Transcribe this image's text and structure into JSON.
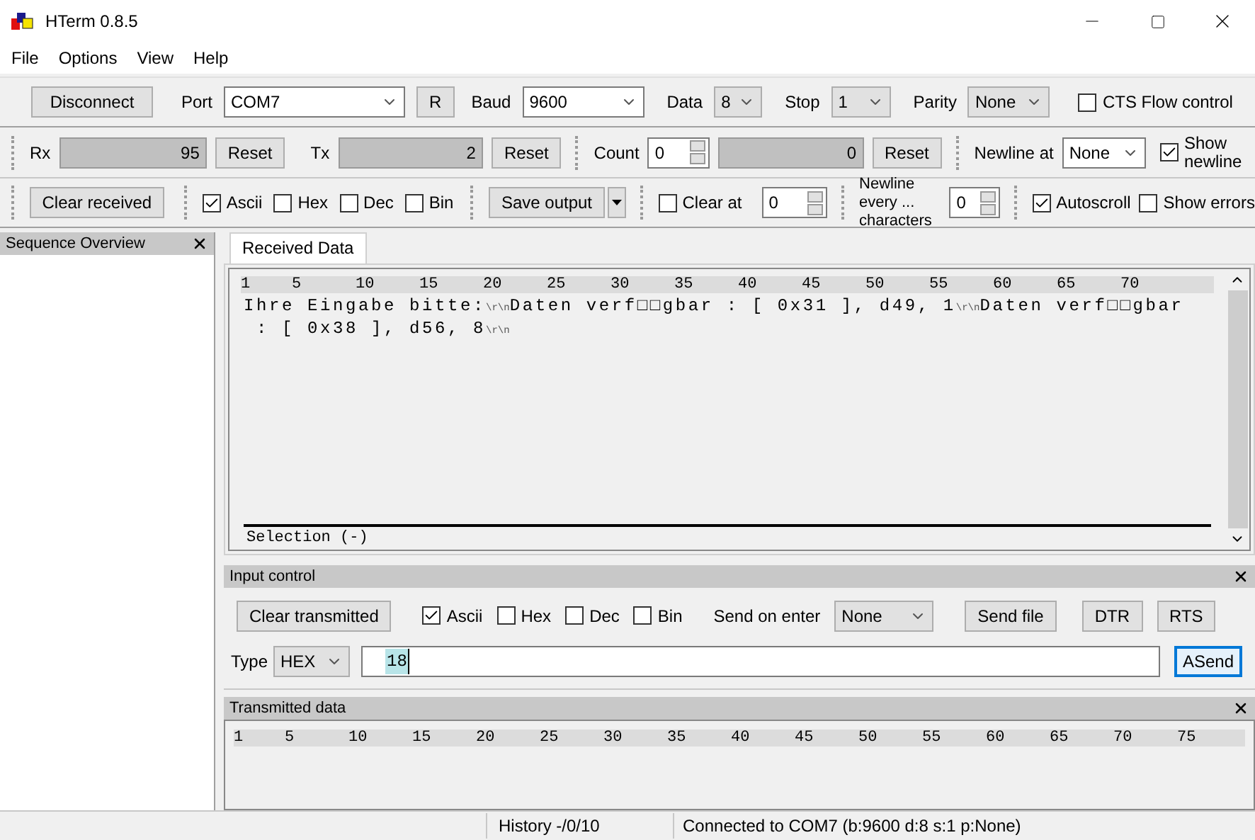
{
  "window": {
    "title": "HTerm 0.8.5"
  },
  "menu": [
    "File",
    "Options",
    "View",
    "Help"
  ],
  "connection": {
    "connect_button": "Disconnect",
    "port_label": "Port",
    "port": "COM7",
    "refresh_button": "R",
    "baud_label": "Baud",
    "baud": "9600",
    "data_label": "Data",
    "data": "8",
    "stop_label": "Stop",
    "stop": "1",
    "parity_label": "Parity",
    "parity": "None",
    "cts": {
      "label": "CTS Flow control",
      "checked": false
    }
  },
  "counters": {
    "rx_label": "Rx",
    "rx": "95",
    "rx_reset": "Reset",
    "tx_label": "Tx",
    "tx": "2",
    "tx_reset": "Reset",
    "count_label": "Count",
    "count": "0",
    "count_value": "0",
    "count_reset": "Reset",
    "newline_label": "Newline at",
    "newline": "None",
    "show_newline": {
      "label": "Show newline",
      "checked": true
    }
  },
  "display": {
    "clear_button": "Clear received",
    "formats": [
      {
        "label": "Ascii",
        "checked": true
      },
      {
        "label": "Hex",
        "checked": false
      },
      {
        "label": "Dec",
        "checked": false
      },
      {
        "label": "Bin",
        "checked": false
      }
    ],
    "save_button": "Save output",
    "clear_at": {
      "label": "Clear at",
      "checked": false,
      "value": "0"
    },
    "newline_every_label": "Newline every ... characters",
    "newline_every": "0",
    "autoscroll": {
      "label": "Autoscroll",
      "checked": true
    },
    "show_errors": {
      "label": "Show errors",
      "checked": false
    }
  },
  "sequence_panel": {
    "title": "Sequence Overview"
  },
  "received": {
    "tab": "Received Data",
    "ruler": [
      "1",
      "5",
      "10",
      "15",
      "20",
      "25",
      "30",
      "35",
      "40",
      "45",
      "50",
      "55",
      "60",
      "65",
      "70"
    ],
    "lines": [
      [
        {
          "kind": "text",
          "text": "Ihre Eingabe bitte:"
        },
        {
          "kind": "eol",
          "text": "\\r\\n"
        },
        {
          "kind": "text",
          "text": "Daten verf□□gbar : [ 0x31 ], d49, 1"
        },
        {
          "kind": "eol",
          "text": "\\r\\n"
        },
        {
          "kind": "text",
          "text": "Daten verf□□gbar"
        }
      ],
      [
        {
          "kind": "text",
          "text": " : [ 0x38 ], d56, 8"
        },
        {
          "kind": "eol",
          "text": "\\r\\n"
        }
      ]
    ],
    "selection": "Selection (-)"
  },
  "input_control": {
    "title": "Input control",
    "clear_button": "Clear transmitted",
    "formats": [
      {
        "label": "Ascii",
        "checked": true
      },
      {
        "label": "Hex",
        "checked": false
      },
      {
        "label": "Dec",
        "checked": false
      },
      {
        "label": "Bin",
        "checked": false
      }
    ],
    "send_on_enter_label": "Send on enter",
    "send_on_enter": "None",
    "send_file": "Send file",
    "dtr": "DTR",
    "rts": "RTS",
    "type_label": "Type",
    "type": "HEX",
    "value": "18",
    "send_button": "ASend"
  },
  "transmitted": {
    "title": "Transmitted data",
    "ruler": [
      "1",
      "5",
      "10",
      "15",
      "20",
      "25",
      "30",
      "35",
      "40",
      "45",
      "50",
      "55",
      "60",
      "65",
      "70",
      "75"
    ]
  },
  "status_bar": [
    "History -/0/10",
    "Connected to COM7 (b:9600 d:8 s:1 p:None)"
  ]
}
